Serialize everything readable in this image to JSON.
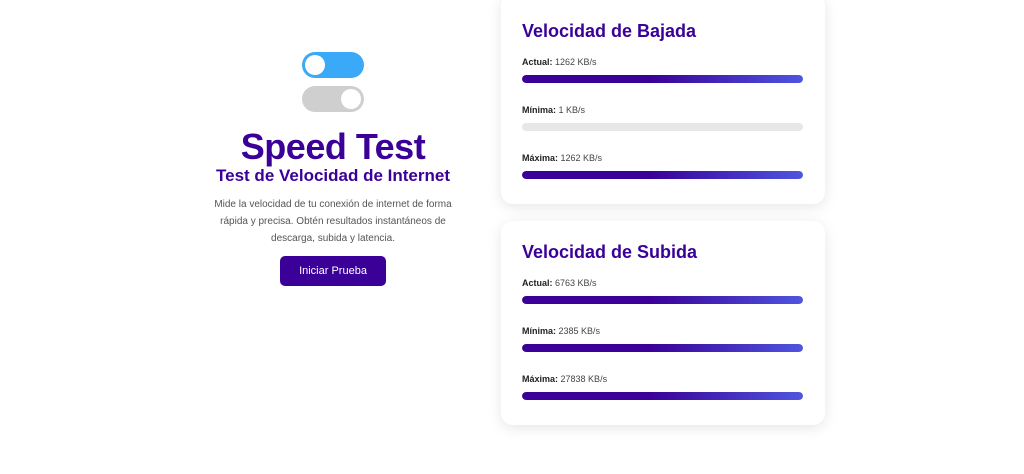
{
  "colors": {
    "primary": "#3a0097",
    "gradient_end": "#4f55e0",
    "toggle_on": "#3aa9f8",
    "toggle_off": "#cfcfcf",
    "track": "#e5e7e9"
  },
  "hero": {
    "logo_icon": "toggle-switches-icon",
    "title": "Speed Test",
    "subtitle": "Test de Velocidad de Internet",
    "description": "Mide la velocidad de tu conexión de internet de forma rápida y precisa. Obtén resultados instantáneos de descarga, subida y latencia.",
    "start_label": "Iniciar Prueba"
  },
  "download": {
    "title": "Velocidad de Bajada",
    "metrics": [
      {
        "label": "Actual:",
        "value": "1262 KB/s",
        "fill": 1.0
      },
      {
        "label": "Mínima:",
        "value": "1 KB/s",
        "fill": 0.0
      },
      {
        "label": "Máxima:",
        "value": "1262 KB/s",
        "fill": 1.0
      }
    ]
  },
  "upload": {
    "title": "Velocidad de Subida",
    "metrics": [
      {
        "label": "Actual:",
        "value": "6763 KB/s",
        "fill": 1.0
      },
      {
        "label": "Mínima:",
        "value": "2385 KB/s",
        "fill": 1.0
      },
      {
        "label": "Máxima:",
        "value": "27838 KB/s",
        "fill": 1.0
      }
    ]
  }
}
